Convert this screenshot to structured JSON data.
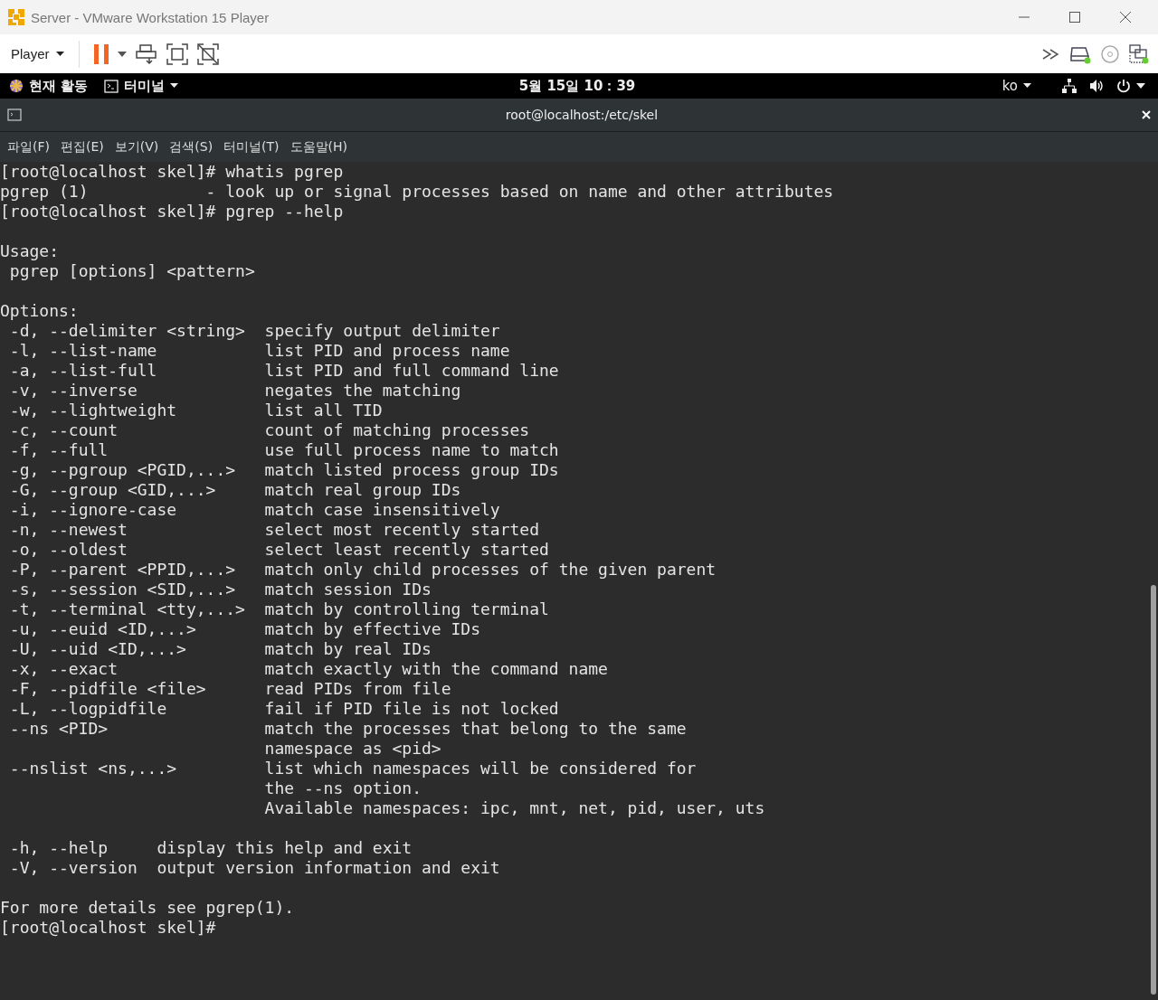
{
  "window": {
    "title": "Server - VMware Workstation 15 Player"
  },
  "toolbar": {
    "player_menu": "Player"
  },
  "top_bar": {
    "activities": "현재 활동",
    "app_menu": "터미널",
    "clock": "5월 15일  10：39",
    "input_method": "ko"
  },
  "terminal": {
    "title": "root@localhost:/etc/skel",
    "menu": [
      "파일(F)",
      "편집(E)",
      "보기(V)",
      "검색(S)",
      "터미널(T)",
      "도움말(H)"
    ],
    "lines": [
      {
        "kind": "text",
        "text": "[root@localhost skel]# whatis pgrep"
      },
      {
        "kind": "text",
        "text": "pgrep (1)            - look up or signal processes based on name and other attributes"
      },
      {
        "kind": "text",
        "text": "[root@localhost skel]# pgrep --help"
      },
      {
        "kind": "blank"
      },
      {
        "kind": "text",
        "text": "Usage:"
      },
      {
        "kind": "text",
        "text": " pgrep [options] <pattern>"
      },
      {
        "kind": "blank"
      },
      {
        "kind": "text",
        "text": "Options:"
      },
      {
        "kind": "text",
        "text": " -d, --delimiter <string>  specify output delimiter"
      },
      {
        "kind": "text",
        "text": " -l, --list-name           list PID and process name"
      },
      {
        "kind": "text",
        "text": " -a, --list-full           list PID and full command line"
      },
      {
        "kind": "text",
        "text": " -v, --inverse             negates the matching"
      },
      {
        "kind": "text",
        "text": " -w, --lightweight         list all TID"
      },
      {
        "kind": "text",
        "text": " -c, --count               count of matching processes"
      },
      {
        "kind": "text",
        "text": " -f, --full                use full process name to match"
      },
      {
        "kind": "text",
        "text": " -g, --pgroup <PGID,...>   match listed process group IDs"
      },
      {
        "kind": "text",
        "text": " -G, --group <GID,...>     match real group IDs"
      },
      {
        "kind": "text",
        "text": " -i, --ignore-case         match case insensitively"
      },
      {
        "kind": "text",
        "text": " -n, --newest              select most recently started"
      },
      {
        "kind": "text",
        "text": " -o, --oldest              select least recently started"
      },
      {
        "kind": "text",
        "text": " -P, --parent <PPID,...>   match only child processes of the given parent"
      },
      {
        "kind": "text",
        "text": " -s, --session <SID,...>   match session IDs"
      },
      {
        "kind": "text",
        "text": " -t, --terminal <tty,...>  match by controlling terminal"
      },
      {
        "kind": "text",
        "text": " -u, --euid <ID,...>       match by effective IDs"
      },
      {
        "kind": "text",
        "text": " -U, --uid <ID,...>        match by real IDs"
      },
      {
        "kind": "text",
        "text": " -x, --exact               match exactly with the command name"
      },
      {
        "kind": "text",
        "text": " -F, --pidfile <file>      read PIDs from file"
      },
      {
        "kind": "text",
        "text": " -L, --logpidfile          fail if PID file is not locked"
      },
      {
        "kind": "text",
        "text": " --ns <PID>                match the processes that belong to the same"
      },
      {
        "kind": "text",
        "text": "                           namespace as <pid>"
      },
      {
        "kind": "text",
        "text": " --nslist <ns,...>         list which namespaces will be considered for"
      },
      {
        "kind": "text",
        "text": "                           the --ns option."
      },
      {
        "kind": "text",
        "text": "                           Available namespaces: ipc, mnt, net, pid, user, uts"
      },
      {
        "kind": "blank"
      },
      {
        "kind": "text",
        "text": " -h, --help     display this help and exit"
      },
      {
        "kind": "text",
        "text": " -V, --version  output version information and exit"
      },
      {
        "kind": "blank"
      },
      {
        "kind": "text",
        "text": "For more details see pgrep(1)."
      },
      {
        "kind": "text",
        "text": "[root@localhost skel]#"
      }
    ]
  }
}
